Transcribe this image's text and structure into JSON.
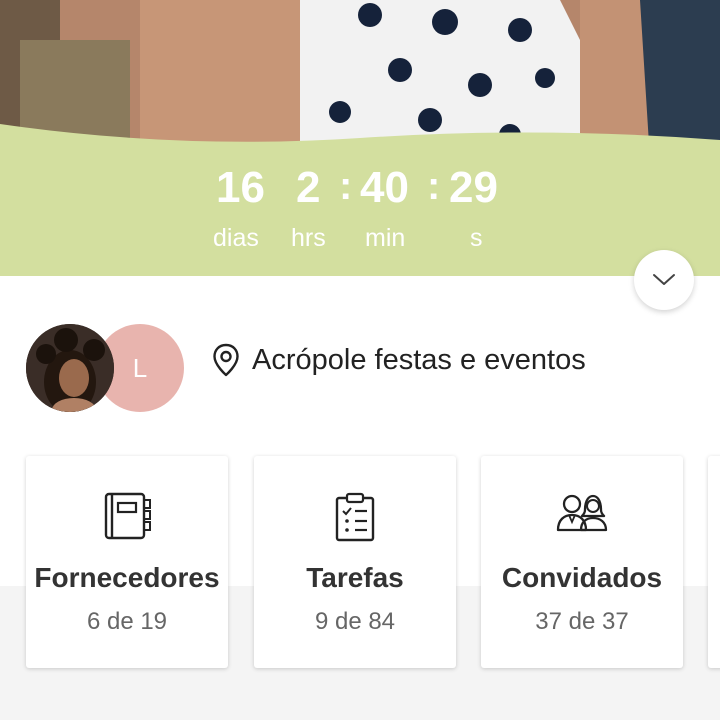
{
  "countdown": {
    "days": "16",
    "hours": "2",
    "minutes": "40",
    "seconds": "29",
    "separator": ":",
    "days_label": "dias",
    "hours_label": "hrs",
    "minutes_label": "min",
    "seconds_label": "s"
  },
  "expand_icon": "chevron-down-icon",
  "couple": {
    "partner_initial": "L"
  },
  "venue": {
    "icon": "location-pin-icon",
    "name": "Acrópole festas e eventos"
  },
  "cards": [
    {
      "icon": "notebook-icon",
      "title": "Fornecedores",
      "count": "6 de 19"
    },
    {
      "icon": "checklist-icon",
      "title": "Tarefas",
      "count": "9 de 84"
    },
    {
      "icon": "guests-icon",
      "title": "Convidados",
      "count": "37 de 37"
    }
  ],
  "colors": {
    "band": "#d3df9f",
    "avatar_letter_bg": "#e8b4ae",
    "text_dark": "#222222"
  }
}
